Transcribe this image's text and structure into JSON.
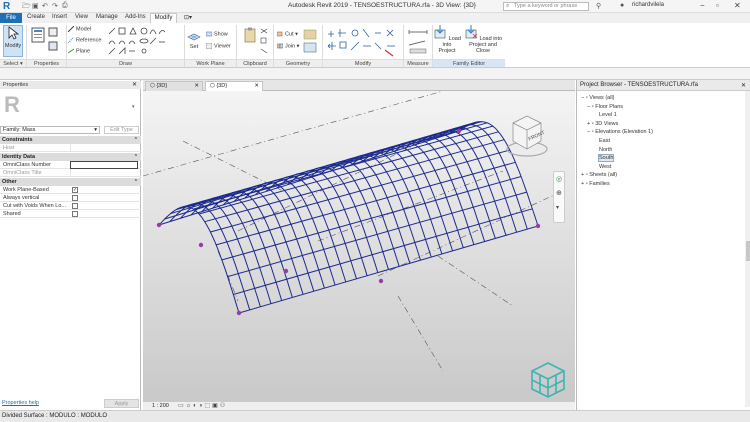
{
  "app": {
    "title": "Autodesk Revit 2019 -  TENSOESTRUCTURA.rfa - 3D View: {3D}",
    "logo_letter": "R",
    "search_placeholder": "Type a keyword or phrase",
    "user": "richardvilela"
  },
  "tabs": [
    "File",
    "Create",
    "Insert",
    "View",
    "Manage",
    "Add-Ins",
    "Modify"
  ],
  "ribbon": {
    "select": {
      "modify": "Modify",
      "label": "Select ▾"
    },
    "properties": {
      "label": "Properties"
    },
    "draw": {
      "model": "Model",
      "reference": "Reference",
      "plane": "Plane",
      "label": "Draw"
    },
    "work_plane": {
      "set": "Set",
      "show": "Show",
      "viewer": "Viewer",
      "label": "Work Plane"
    },
    "clipboard": {
      "label": "Clipboard"
    },
    "geometry": {
      "cut": "Cut",
      "join": "Join",
      "label": "Geometry"
    },
    "modify": {
      "label": "Modify"
    },
    "measure": {
      "label": "Measure"
    },
    "family_editor": {
      "load_project": "Load into\nProject",
      "load_close": "Load into\nProject and Close",
      "label": "Family Editor"
    }
  },
  "properties": {
    "title": "Properties",
    "family_selector": "Family: Mass",
    "edit_type": "Edit Type",
    "groups": [
      {
        "name": "Constraints",
        "rows": [
          {
            "key": "Host",
            "value": ""
          }
        ]
      },
      {
        "name": "Identity Data",
        "rows": [
          {
            "key": "OmniClass Number",
            "value": ""
          },
          {
            "key": "OmniClass Title",
            "value": ""
          }
        ]
      },
      {
        "name": "Other",
        "rows": [
          {
            "key": "Work Plane-Based",
            "checked": true
          },
          {
            "key": "Always vertical",
            "checked": false
          },
          {
            "key": "Cut with Voids When Lo...",
            "checked": false
          },
          {
            "key": "Shared",
            "checked": false
          }
        ]
      }
    ],
    "help_link": "Properties help",
    "apply": "Apply"
  },
  "view_tabs": [
    {
      "label": "{3D}"
    },
    {
      "label": "{3D}"
    }
  ],
  "viewcube_face": "FRONT",
  "view_scale": "1 : 200",
  "browser": {
    "title": "Project Browser - TENSOESTRUCTURA.rfa",
    "tree": [
      {
        "label": "Views (all)",
        "level": 0,
        "toggle": "−"
      },
      {
        "label": "Floor Plans",
        "level": 1,
        "toggle": "−"
      },
      {
        "label": "Level 1",
        "level": 3,
        "toggle": ""
      },
      {
        "label": "3D Views",
        "level": 1,
        "toggle": "+"
      },
      {
        "label": "Elevations (Elevation 1)",
        "level": 1,
        "toggle": "−"
      },
      {
        "label": "East",
        "level": 3,
        "toggle": ""
      },
      {
        "label": "North",
        "level": 3,
        "toggle": ""
      },
      {
        "label": "South",
        "level": 3,
        "toggle": "",
        "selected": true
      },
      {
        "label": "West",
        "level": 3,
        "toggle": ""
      },
      {
        "label": "Sheets (all)",
        "level": 0,
        "toggle": "+"
      },
      {
        "label": "Families",
        "level": 0,
        "toggle": "+"
      }
    ]
  },
  "status": {
    "text": "Divided Surface : MODULO : MODULO"
  },
  "colors": {
    "accent": "#1e6fb8",
    "mesh": "#1b2a8c",
    "family_editor_bg": "#d6e6f5"
  }
}
